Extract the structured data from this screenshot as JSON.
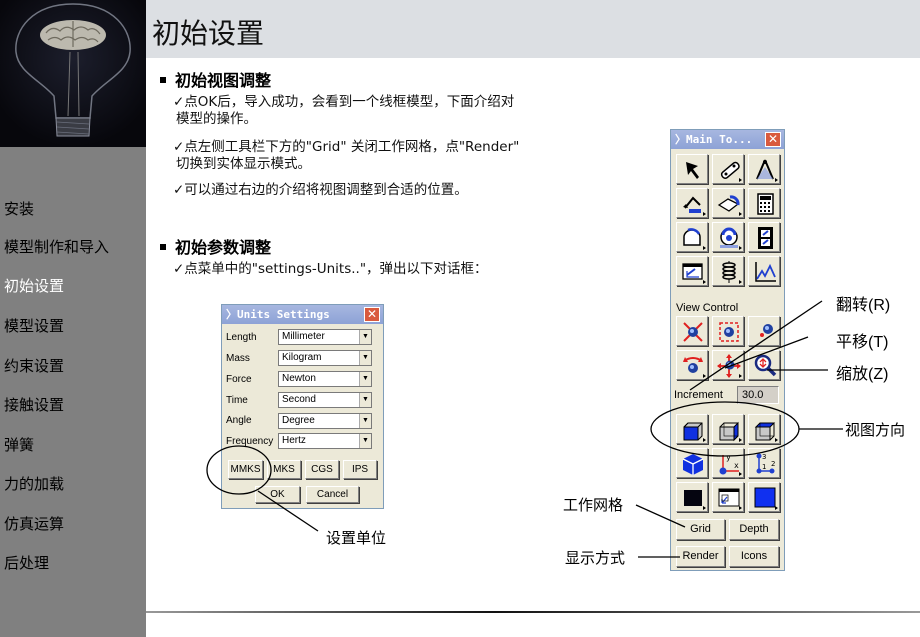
{
  "sidebar": {
    "items": [
      {
        "label": "安装",
        "active": false
      },
      {
        "label": "模型制作和导入",
        "active": false
      },
      {
        "label": "初始设置",
        "active": true
      },
      {
        "label": "模型设置",
        "active": false
      },
      {
        "label": "约束设置",
        "active": false
      },
      {
        "label": "接触设置",
        "active": false
      },
      {
        "label": "弹簧",
        "active": false
      },
      {
        "label": "力的加载",
        "active": false
      },
      {
        "label": "仿真运算",
        "active": false
      },
      {
        "label": "后处理",
        "active": false
      }
    ]
  },
  "header": {
    "title": "初始设置"
  },
  "sections": [
    {
      "heading": "初始视图调整",
      "bullets": [
        "✓点OK后，导入成功，会看到一个线框模型，下面介绍对",
        "模型的操作。",
        "✓点左侧工具栏下方的\"Grid\" 关闭工作网格，点\"Render\"",
        "切换到实体显示模式。",
        "✓可以通过右边的介绍将视图调整到合适的位置。"
      ]
    },
    {
      "heading": "初始参数调整",
      "bullets": [
        "✓点菜单中的\"settings-Units..\"，弹出以下对话框："
      ]
    }
  ],
  "units_dialog": {
    "title": "Units Settings",
    "rows": [
      {
        "label": "Length",
        "value": "Millimeter"
      },
      {
        "label": "Mass",
        "value": "Kilogram"
      },
      {
        "label": "Force",
        "value": "Newton"
      },
      {
        "label": "Time",
        "value": "Second"
      },
      {
        "label": "Angle",
        "value": "Degree"
      },
      {
        "label": "Frequency",
        "value": "Hertz"
      }
    ],
    "presets": [
      "MMKS",
      "MKS",
      "CGS",
      "IPS"
    ],
    "ok": "OK",
    "cancel": "Cancel",
    "annotation": "设置单位"
  },
  "toolbar": {
    "title": "Main To...",
    "view_control_label": "View Control",
    "increment_label": "Increment",
    "increment_value": "30.0",
    "grid": "Grid",
    "depth": "Depth",
    "render": "Render",
    "icons": "Icons"
  },
  "callouts": {
    "rotate": "翻转(R)",
    "translate": "平移(T)",
    "zoom": "缩放(Z)",
    "view_direction": "视图方向",
    "work_grid": "工作网格",
    "display_mode": "显示方式"
  }
}
